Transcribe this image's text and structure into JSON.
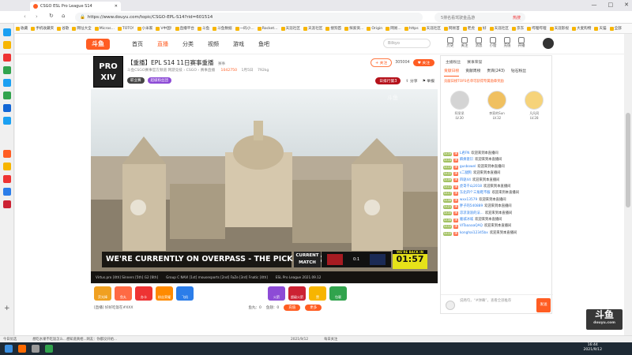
{
  "browser": {
    "tab_title": "CSGO ESL Pro League S14",
    "url": "https://www.douyu.com/topic/CSGO-EPL-S14?rid=601514",
    "search_placeholder": "5排名看驾驶金品游",
    "search_hint": "热搜",
    "bookmarks": [
      "收藏",
      "手机收藏夹",
      "谷歌",
      "网址大全",
      "Micros...",
      "TOTO!",
      "小米家",
      "V中国!",
      "直播平台",
      "斗鱼",
      "斗鱼数据",
      "一码小...",
      "Rocket...",
      "天涯社区",
      "天涯社区",
      "搜狗首",
      "探索资...",
      "Origin",
      "网易...",
      "https",
      "天涯社区",
      "网易首",
      "老虎",
      "好",
      "天涯社区",
      "京东",
      "哔哩哔哩",
      "天涯影视",
      "大麦购物",
      "天猫",
      "全部"
    ]
  },
  "nav": {
    "logo": "斗鱼",
    "items": [
      "首页",
      "直播",
      "分类",
      "视频",
      "游戏",
      "鱼吧"
    ],
    "search_placeholder": "Bilkyo",
    "icons": [
      "历史",
      "关注",
      "消息",
      "小窗",
      "充值",
      "开播"
    ]
  },
  "room": {
    "avatar_text": "PRO XIV",
    "title": "【重播】EPL S14 11日赛事重播",
    "category_tag": "赛事",
    "sub": "斗鱼CSGO赛事官方频道   网游竞技 › CSGO › 赛事直播",
    "hot": "1042750",
    "level": "1月5日",
    "fans": "792kg",
    "tags": [
      "职业赛",
      "超级粉丝团"
    ],
    "follow_count": "305004",
    "follow_label": "关注",
    "share_label": "分享",
    "report_label": "举报",
    "rank_label": "日排行第3",
    "client_label": "客户端"
  },
  "video": {
    "watermark": "斗鱼",
    "overlay_title": "WE'RE CURRENTLY ON OVERPASS - THE PICK OF LIQUID",
    "current_match": [
      "CURRENT",
      "MATCH"
    ],
    "score": "0:1",
    "timer_label": "WE'RE BACK IN",
    "timer": "01:57",
    "ticker": [
      "Virtus.pro [4th]  Sinners [5th]  G2 [6th]",
      "Group C NAVI [1st]  mousesports [2nd]  FaZe [3rd]  Fnatic [4th]",
      "ESL Pro League 2021.09.12"
    ]
  },
  "gifts": [
    "荧光棒",
    "鱼丸",
    "办卡",
    "粉丝荣耀",
    "飞机",
    "火箭",
    "超级火箭",
    "赞",
    "包裹"
  ],
  "below": {
    "left": "[直播] 好好吃饭在#XXX",
    "stat1": "鱼丸：0",
    "stat2": "鱼翅：0",
    "charge": "充值",
    "more": "更多"
  },
  "chat": {
    "top": [
      "主播粉丝",
      "赛事荣誉"
    ],
    "tabs": [
      "贡献日榜",
      "贡献周榜",
      "贵宾(243)",
      "钻石粉丝"
    ],
    "rank_title": "贡献日榜TOP3名单可获得专属勋章奖励",
    "fans": [
      {
        "name": "阿呆呆",
        "lv": "LV.30"
      },
      {
        "name": "李家的Sun",
        "lv": "LV.32"
      },
      {
        "name": "凡凡同",
        "lv": "LV.28"
      }
    ],
    "messages": [
      {
        "lv": "LV.19",
        "name": "L君FN",
        "text": "欢迎来到本直播间"
      },
      {
        "lv": "LV.14",
        "name": "麻痹意识",
        "text": "欢迎来到本直播间"
      },
      {
        "lv": "LV.13",
        "name": "gusbowel",
        "text": "欢迎来到本直播间"
      },
      {
        "lv": "LV.22",
        "name": "s二腿狗",
        "text": "欢迎来到本直播间"
      },
      {
        "lv": "LV.09",
        "name": "四驱44",
        "text": "欢迎来到本直播间"
      },
      {
        "lv": "LV.11",
        "name": "虎哥千山2018",
        "text": "欢迎来到本直播间"
      },
      {
        "lv": "LV.17",
        "name": "东北四个三角鞋不服",
        "text": "欢迎来到本直播间"
      },
      {
        "lv": "LV.08",
        "name": "wxx13579",
        "text": "欢迎来到本直播间"
      },
      {
        "lv": "LV.21",
        "name": "胖子的540889",
        "text": "欢迎来到本直播间"
      },
      {
        "lv": "LV.10",
        "name": "凉凉浪浪的法...",
        "text": "欢迎来到本直播间"
      },
      {
        "lv": "LV.06",
        "name": "雁城冰城",
        "text": "欢迎来到本直播间"
      },
      {
        "lv": "LV.12",
        "name": "VITaaaaaQAQ",
        "text": "欢迎来到本直播间"
      },
      {
        "lv": "LV.15",
        "name": "konghai12345bx",
        "text": "欢迎来到本直播间"
      }
    ],
    "input_placeholder": "说两句，“#弹幕”，查看全部推荐",
    "send": "发送"
  },
  "overlay_logo": {
    "main": "斗鱼",
    "sub": "douyu.com"
  },
  "statusbar": [
    "今日优选",
    "想吃水果不吃饭怎么...想知道真相...网友：你都没开始...",
    "2021/9/12",
    "每日关注"
  ],
  "taskbar": {
    "time": "16:44",
    "date": "2021/9/12"
  },
  "colors": {
    "brand": "#ff5d23"
  }
}
